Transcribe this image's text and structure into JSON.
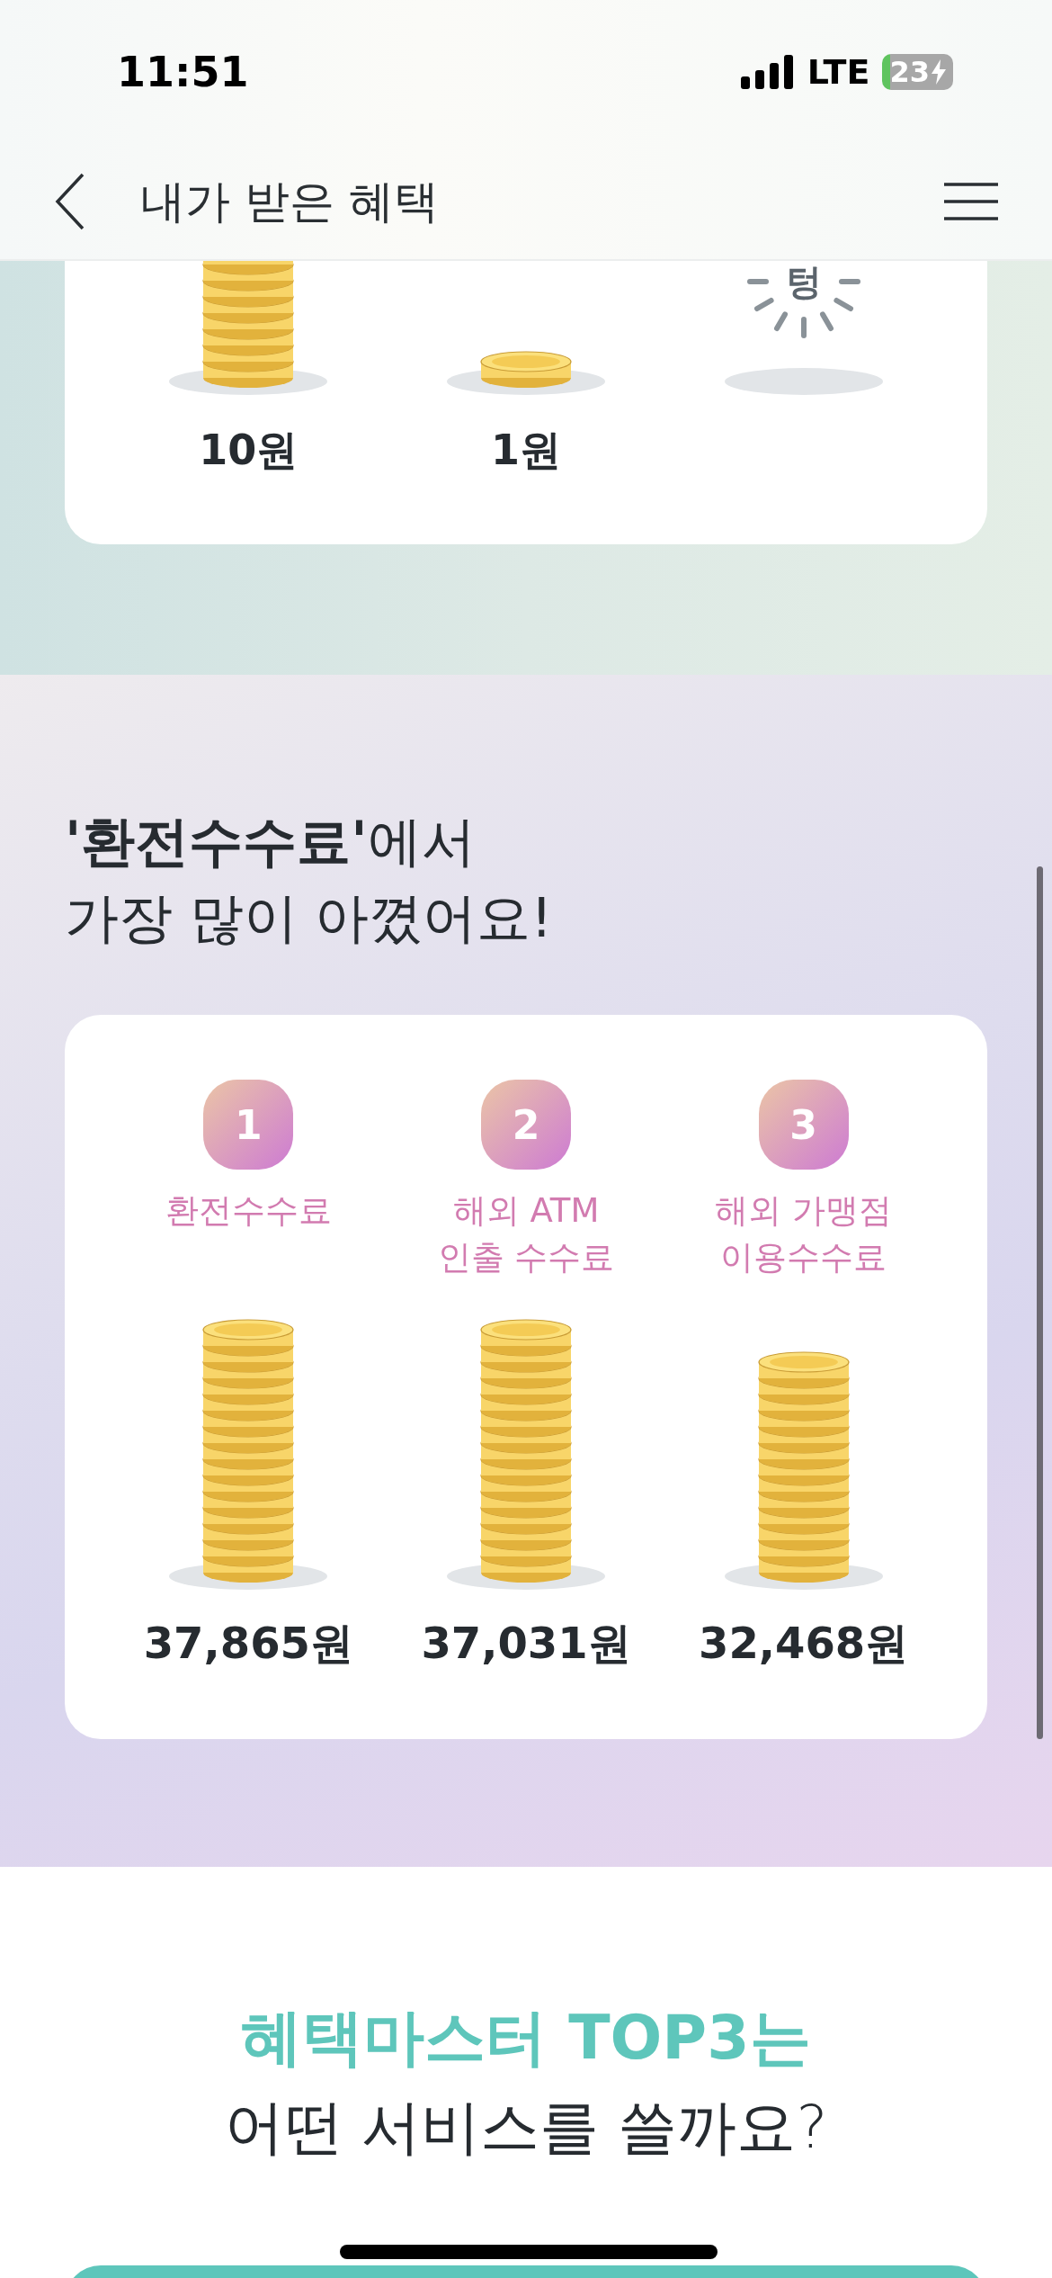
{
  "status_bar": {
    "time": "11:51",
    "network": "LTE",
    "battery": "23"
  },
  "header": {
    "title": "내가 받은 혜택"
  },
  "summary_card": {
    "items": [
      {
        "kind": "stack",
        "amount": "10원"
      },
      {
        "kind": "coin",
        "amount": "1원"
      },
      {
        "kind": "empty",
        "sound": "텅"
      }
    ]
  },
  "top_fee": {
    "heading": "**'환전수수료'**에서\n가장 많이 아꼈어요!",
    "ranks": [
      {
        "rank": "1",
        "name": "환전수수료",
        "amount": "37,865원"
      },
      {
        "rank": "2",
        "name": "해외 ATM\n인출 수수료",
        "amount": "37,031원"
      },
      {
        "rank": "3",
        "name": "해외 가맹점\n이용수수료",
        "amount": "32,468원"
      }
    ]
  },
  "masters": {
    "title": "혜택마스터 TOP3는",
    "subtitle": "어떤 서비스를 쓸까요?"
  }
}
